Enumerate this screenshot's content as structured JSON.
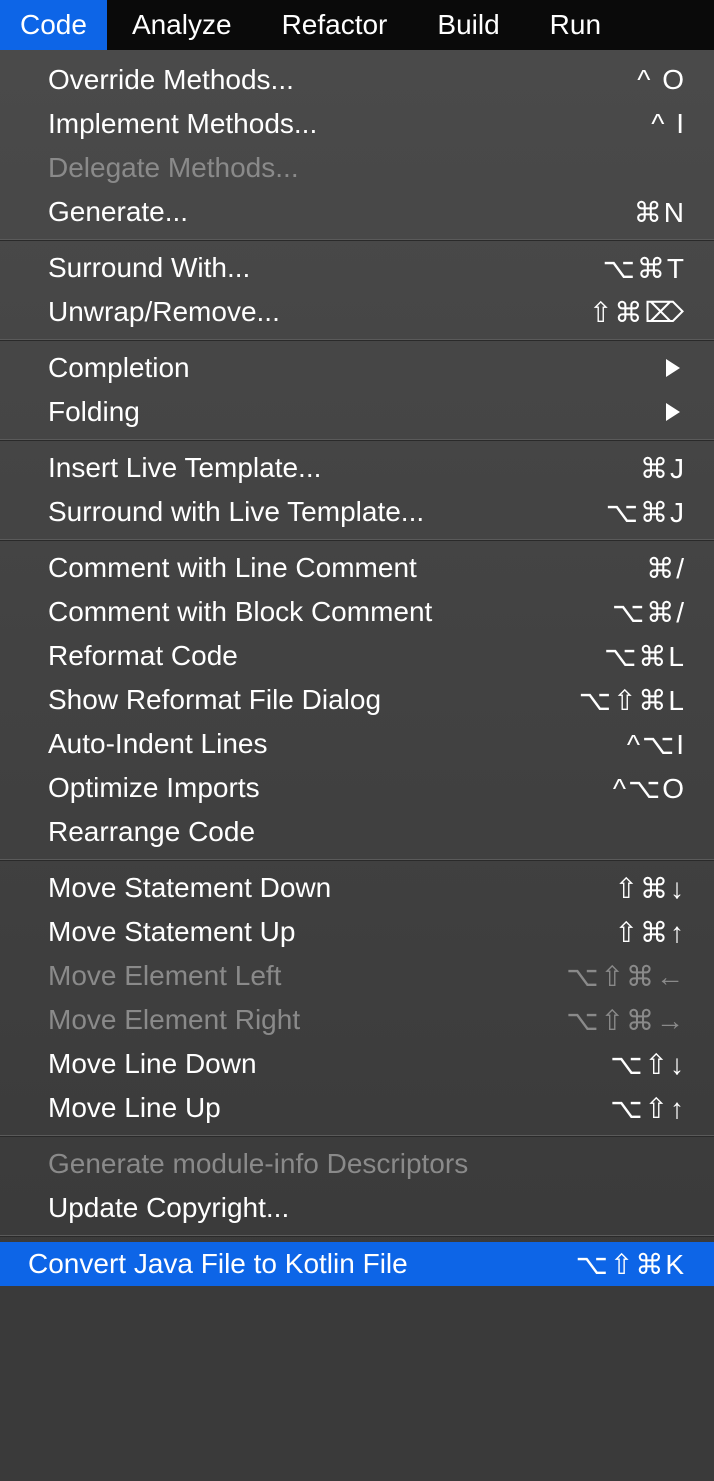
{
  "menubar": {
    "items": [
      {
        "label": "Code",
        "active": true
      },
      {
        "label": "Analyze"
      },
      {
        "label": "Refactor"
      },
      {
        "label": "Build"
      },
      {
        "label": "Run"
      }
    ]
  },
  "dropdown": {
    "sections": [
      [
        {
          "label": "Override Methods...",
          "shortcut": "^ O"
        },
        {
          "label": "Implement Methods...",
          "shortcut": "^ I"
        },
        {
          "label": "Delegate Methods...",
          "disabled": true
        },
        {
          "label": "Generate...",
          "shortcut": "⌘N"
        }
      ],
      [
        {
          "label": "Surround With...",
          "shortcut": "⌥⌘T"
        },
        {
          "label": "Unwrap/Remove...",
          "shortcut": "⇧⌘⌦"
        }
      ],
      [
        {
          "label": "Completion",
          "submenu": true
        },
        {
          "label": "Folding",
          "submenu": true
        }
      ],
      [
        {
          "label": "Insert Live Template...",
          "shortcut": "⌘J"
        },
        {
          "label": "Surround with Live Template...",
          "shortcut": "⌥⌘J"
        }
      ],
      [
        {
          "label": "Comment with Line Comment",
          "shortcut": "⌘/"
        },
        {
          "label": "Comment with Block Comment",
          "shortcut": "⌥⌘/"
        },
        {
          "label": "Reformat Code",
          "shortcut": "⌥⌘L"
        },
        {
          "label": "Show Reformat File Dialog",
          "shortcut": "⌥⇧⌘L"
        },
        {
          "label": "Auto-Indent Lines",
          "shortcut": "^⌥I"
        },
        {
          "label": "Optimize Imports",
          "shortcut": "^⌥O"
        },
        {
          "label": "Rearrange Code"
        }
      ],
      [
        {
          "label": "Move Statement Down",
          "shortcut": "⇧⌘↓"
        },
        {
          "label": "Move Statement Up",
          "shortcut": "⇧⌘↑"
        },
        {
          "label": "Move Element Left",
          "shortcut": "⌥⇧⌘←",
          "disabled": true
        },
        {
          "label": "Move Element Right",
          "shortcut": "⌥⇧⌘→",
          "disabled": true
        },
        {
          "label": "Move Line Down",
          "shortcut": "⌥⇧↓"
        },
        {
          "label": "Move Line Up",
          "shortcut": "⌥⇧↑"
        }
      ],
      [
        {
          "label": "Generate module-info Descriptors",
          "disabled": true
        },
        {
          "label": "Update Copyright..."
        }
      ],
      [
        {
          "label": "Convert Java File to Kotlin File",
          "shortcut": "⌥⇧⌘K",
          "highlighted": true,
          "nopad": true
        }
      ]
    ]
  }
}
